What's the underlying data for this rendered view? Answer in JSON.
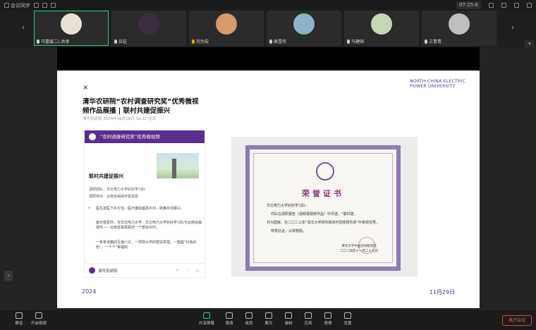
{
  "app": {
    "title": "会议同步"
  },
  "topbar": {
    "status_text": "07:25:6"
  },
  "participants": [
    {
      "name": "马富骏二(-共享",
      "active": true
    },
    {
      "name": "吕征",
      "active": false
    },
    {
      "name": "刘为宏",
      "active": false
    },
    {
      "name": "高雪伟",
      "active": false
    },
    {
      "name": "马建国",
      "active": false
    },
    {
      "name": "三青青",
      "active": false
    }
  ],
  "slide": {
    "university": "NORTH CHINA ELECTRIC\nPOWER UNIVERSITY",
    "close_mark": "×",
    "article_title": "清华农研院“农村调查研究奖”优秀微视频作品展播 | 联村共建促振兴",
    "article_meta": "清华农研院 2024年06月18日 10:22 北京",
    "card_header": "“农村调查研究奖”优秀微视频",
    "section_title": "联村共建促振兴",
    "lines": [
      "调研团队：华北电力大学好好学习队",
      "调研地点：云南省曲靖市富源县"
    ],
    "paragraphs": [
      "医生送医下乡行活，医疗援助基层乡村，助推乡村振兴。",
      "盛日我爱你，在华北电力大学，华北电力大学好好学习队与云南省曲靖市——云南省富源县的一个帮扶对村。",
      "一条条道路的互通八达，一项项大学的帮扶举措，一座座“红色红色”，一个个“幸福的"
    ],
    "card_footer": "清华农研院",
    "cert_title": "荣誉证书",
    "cert_lines": [
      "华北电力大学好好学习队：",
      "你队在调研报告（视频或视频作品）中评选，“联村建，",
      "共为国家。在二〇二三年“清华大学研究院农村调查研究奖”中表现优秀，",
      "特发此证，以资鼓励。"
    ],
    "cert_sign": [
      "清华大学中国农村研究院",
      "二〇二四年十一月二十九日"
    ],
    "year": "2024",
    "date": "11月29日"
  },
  "toolbar": {
    "items": [
      "静音",
      "开启视频",
      "共享屏幕",
      "邀请",
      "成员",
      "聊天",
      "录制",
      "应用",
      "表情",
      "设置"
    ],
    "leave": "离开会议"
  }
}
